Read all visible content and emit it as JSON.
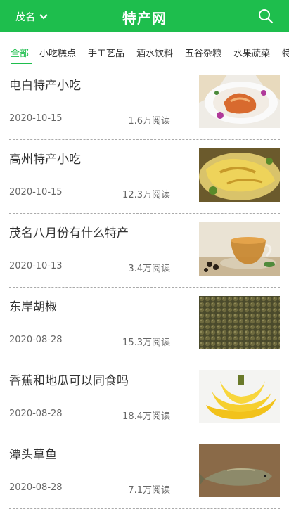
{
  "header": {
    "city": "茂名",
    "brand": "特产网"
  },
  "tabs": [
    "全部",
    "小吃糕点",
    "手工艺品",
    "酒水饮料",
    "五谷杂粮",
    "水果蔬菜",
    "特"
  ],
  "active_tab": 0,
  "articles": [
    {
      "title": "电白特产小吃",
      "date": "2020-10-15",
      "views": "1.6万阅读",
      "thumb": "noodle-dish"
    },
    {
      "title": "高州特产小吃",
      "date": "2020-10-15",
      "views": "12.3万阅读",
      "thumb": "chicken-dish"
    },
    {
      "title": "茂名八月份有什么特产",
      "date": "2020-10-13",
      "views": "3.4万阅读",
      "thumb": "tea-cup"
    },
    {
      "title": "东岸胡椒",
      "date": "2020-08-28",
      "views": "15.3万阅读",
      "thumb": "pepper-corns"
    },
    {
      "title": "香蕉和地瓜可以同食吗",
      "date": "2020-08-28",
      "views": "18.4万阅读",
      "thumb": "bananas"
    },
    {
      "title": "潭头草鱼",
      "date": "2020-08-28",
      "views": "7.1万阅读",
      "thumb": "grass-carp"
    }
  ]
}
